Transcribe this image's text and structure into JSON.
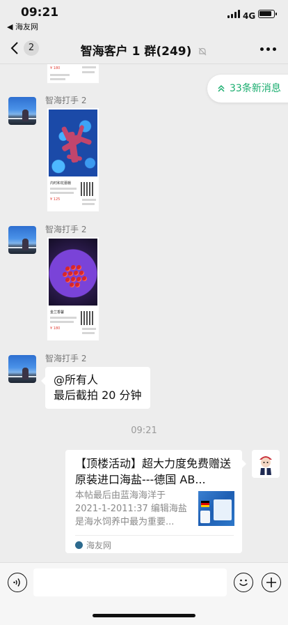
{
  "status_bar": {
    "time": "09:21",
    "back_app": "◀ 海友网",
    "network": "4G"
  },
  "nav": {
    "unread_count": "2",
    "title": "智海客户 1 群(249)"
  },
  "new_messages": {
    "label": "33条新消息"
  },
  "messages": [
    {
      "sender": "智海打手 2",
      "type": "image",
      "image_caption": "内时和花蕾棚",
      "price": "¥ 125"
    },
    {
      "sender": "智海打手 2",
      "type": "image",
      "image_caption": "金兰香馨",
      "price": "¥ 180"
    },
    {
      "sender": "智海打手 2",
      "type": "text",
      "line1": "@所有人",
      "line2": "最后截拍 20 分钟"
    }
  ],
  "top_partial_price": "¥ 180",
  "timestamp": "09:21",
  "link_card": {
    "title": "【顶楼活动】超大力度免费赠送原装进口海盐---德国 AB...",
    "description": "本帖最后由蓝海海洋于 2021-1-2011:37 编辑海盐是海水饲养中最为重要...",
    "source": "海友网"
  },
  "colors": {
    "accent": "#1aad6f",
    "background": "#ededed",
    "price": "#e0433a"
  }
}
